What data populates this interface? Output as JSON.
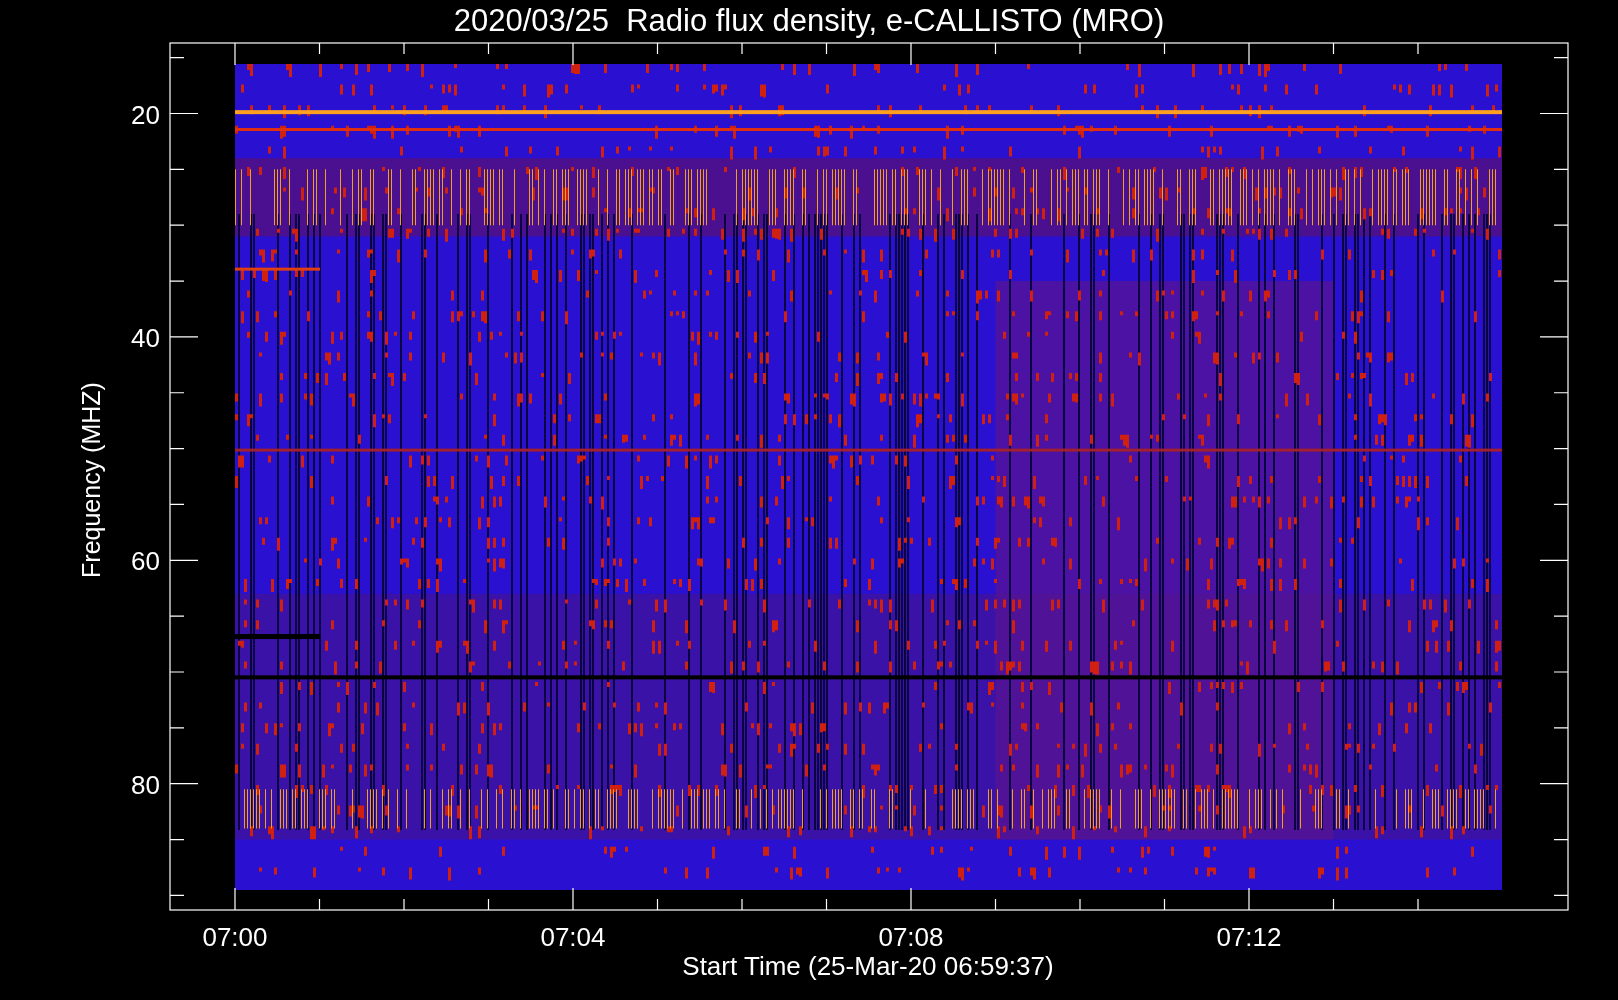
{
  "title": "2020/03/25  Radio flux density, e-CALLISTO (MRO)",
  "y_axis": {
    "label": "Frequency (MHZ)",
    "ticks": [
      "20",
      "40",
      "60",
      "80"
    ]
  },
  "x_axis": {
    "label": "Start Time (25-Mar-20 06:59:37)",
    "ticks": [
      "07:00",
      "07:04",
      "07:08",
      "07:12"
    ]
  }
}
